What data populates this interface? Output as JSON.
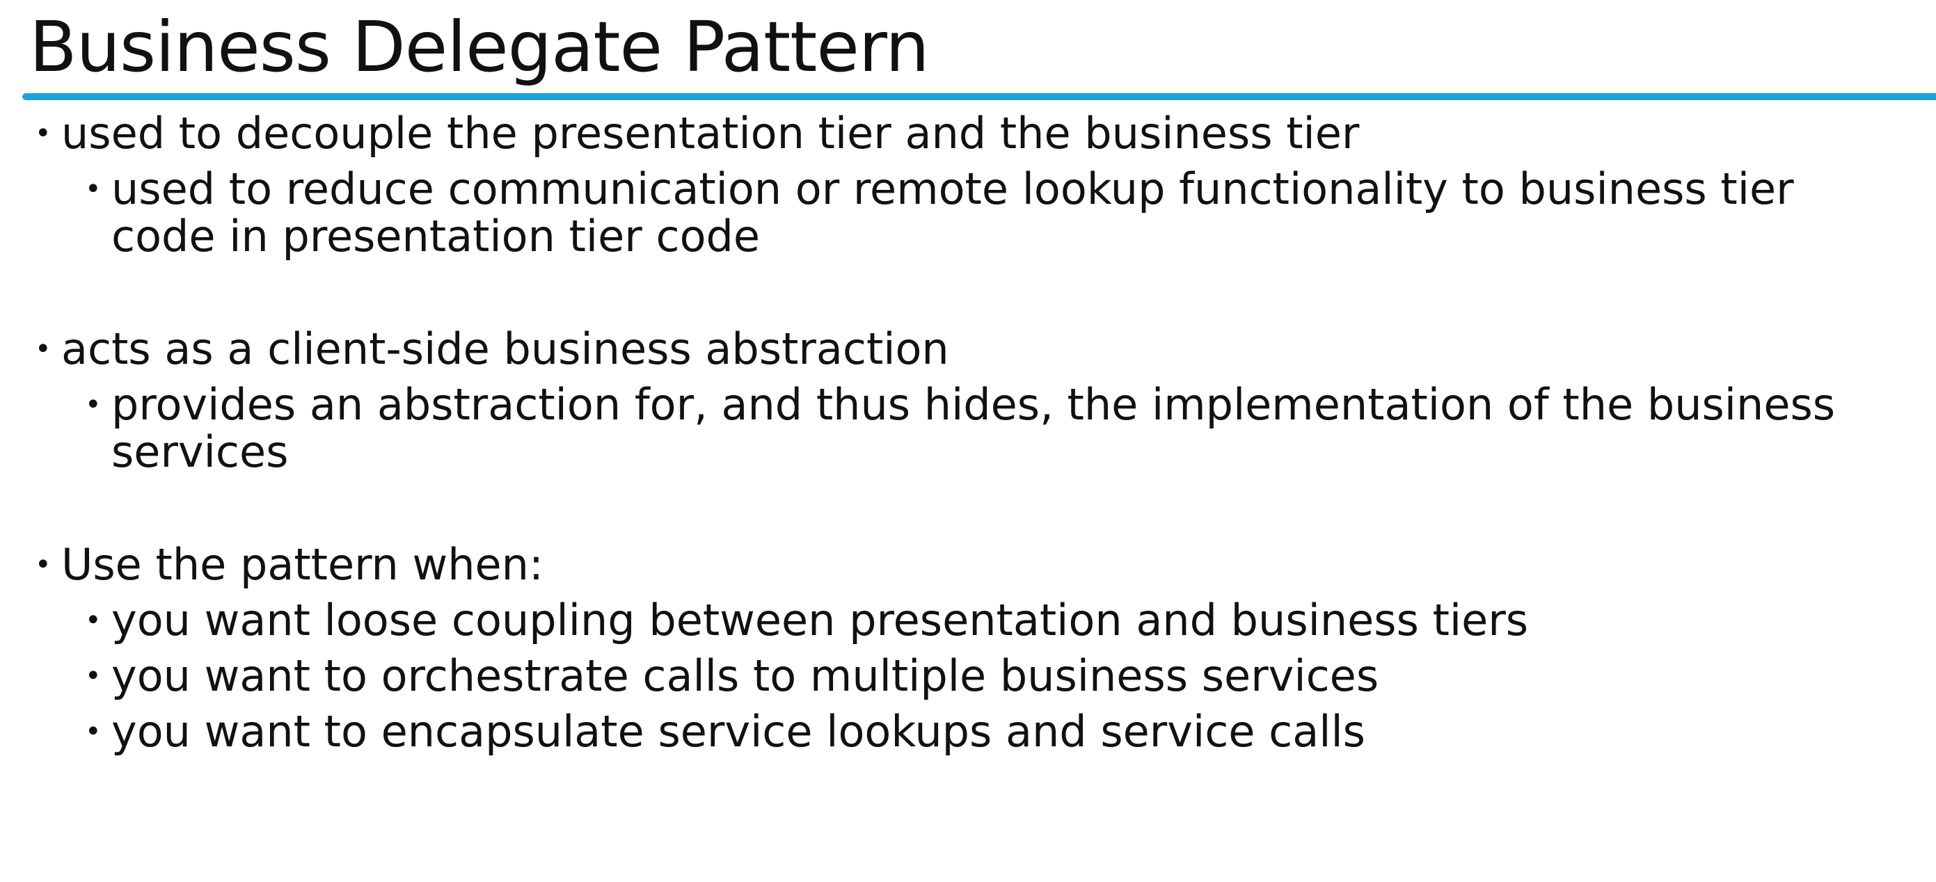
{
  "slide": {
    "title": "Business Delegate Pattern",
    "accent_color": "#1ba1e2",
    "bullet_symbol": "•",
    "groups": [
      {
        "text": "used to decouple the presentation tier and the business tier",
        "subitems": [
          "used to reduce communication or remote lookup functionality to business tier code in presentation tier code"
        ]
      },
      {
        "text": "acts as a client-side business abstraction",
        "subitems": [
          "provides an abstraction for, and thus hides, the implementation of the business services"
        ]
      },
      {
        "text": "Use the pattern when:",
        "subitems": [
          "you want loose coupling between presentation and business tiers",
          "you want to orchestrate calls to multiple business services",
          "you want to encapsulate service lookups and service calls"
        ]
      }
    ]
  }
}
